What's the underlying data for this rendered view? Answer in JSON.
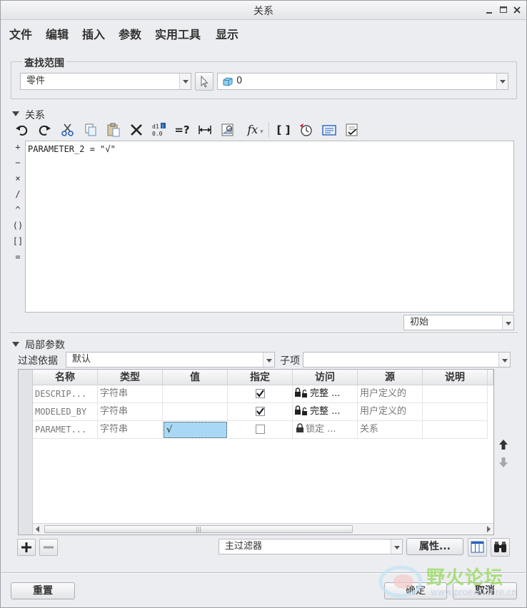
{
  "window": {
    "title": "关系",
    "min_icon": "minimize-icon",
    "max_icon": "maximize-icon",
    "close_icon": "close-icon"
  },
  "menubar": [
    "文件",
    "编辑",
    "插入",
    "参数",
    "实用工具",
    "显示"
  ],
  "lookin": {
    "group_label": "查找范围",
    "type_value": "零件",
    "object_value": "0"
  },
  "relations": {
    "section_label": "关系",
    "toolbar_icons": [
      "undo-icon",
      "redo-icon",
      "cut-icon",
      "copy-icon",
      "paste-icon",
      "delete-icon",
      "sort-icon",
      "evaluate-icon",
      "dimension-icon",
      "verify-icon",
      "function-icon",
      "brackets-icon",
      "units-icon",
      "insert-icon",
      "check-icon"
    ],
    "fx_label": "fx",
    "eq_label": "=?",
    "bracket_label": "[ ]",
    "operators": [
      "+",
      "−",
      "×",
      "/",
      "^",
      "()",
      "[]",
      "="
    ],
    "editor_text": "PARAMETER_2 = \"√\"",
    "state_value": "初始"
  },
  "local_params": {
    "section_label": "局部参数",
    "filter_label": "过滤依据",
    "filter_value": "默认",
    "sub_label": "子项",
    "sub_value": "",
    "columns": [
      "名称",
      "类型",
      "值",
      "指定",
      "访问",
      "源",
      "说明"
    ],
    "rows": [
      {
        "name": "DESCRIP...",
        "type": "字符串",
        "value": "",
        "designated": true,
        "access": "完整 ...",
        "source": "用户定义的",
        "desc": ""
      },
      {
        "name": "MODELED_BY",
        "type": "字符串",
        "value": "",
        "designated": true,
        "access": "完整 ...",
        "source": "用户定义的",
        "desc": ""
      },
      {
        "name": "PARAMET...",
        "type": "字符串",
        "value": "√",
        "designated": false,
        "access": "锁定 ...",
        "source": "关系",
        "desc": ""
      }
    ],
    "main_filter": "主过滤器",
    "properties_label": "属性...",
    "add_icon": "plus-icon",
    "remove_icon": "minus-icon",
    "columns_icon": "columns-icon",
    "find_icon": "binoculars-icon",
    "up_icon": "arrow-up-icon",
    "down_icon": "arrow-down-icon"
  },
  "footer": {
    "reset_label": "重置",
    "ok_label": "确定",
    "cancel_label": "取消"
  },
  "watermark": {
    "text": "野火论坛",
    "url": "www.proewildfire.cn"
  }
}
